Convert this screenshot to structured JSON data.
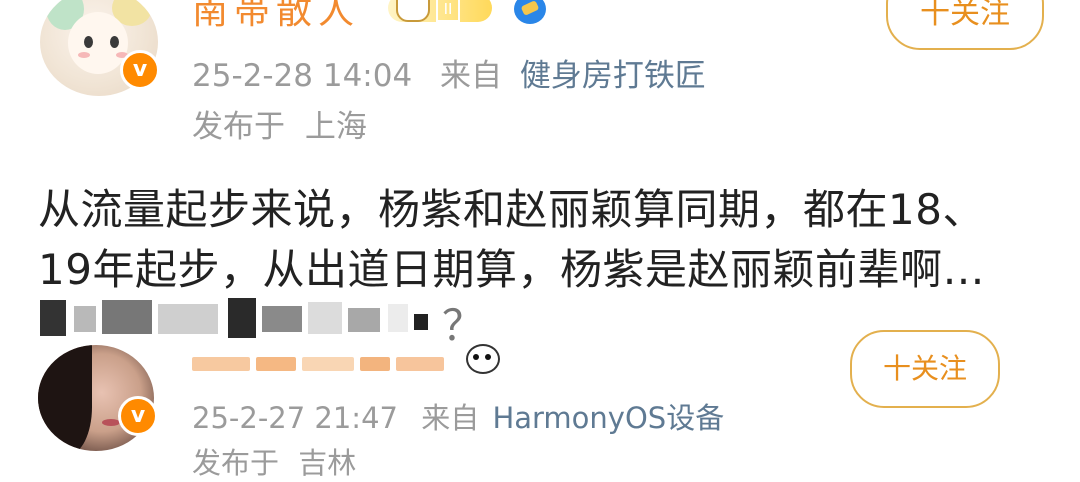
{
  "post1": {
    "username": "南帯散人",
    "timestamp": "25-2-28 14:04",
    "source_prefix": "来自",
    "source": "健身房打铁匠",
    "location_prefix": "发布于",
    "location": "上海",
    "follow_label": "十关注",
    "verified_mark": "v",
    "content_line1": "从流量起步来说，杨紫和赵丽颖算同期，都在18、",
    "content_line2": "19年起步，从出道日期算，杨紫是赵丽颖前辈啊…",
    "content_line3_visible_end": "？"
  },
  "post2": {
    "timestamp": "25-2-27 21:47",
    "source_prefix": "来自",
    "source": "HarmonyOS设备",
    "location_prefix": "发布于",
    "location": "吉林",
    "follow_label": "十关注",
    "verified_mark": "v"
  },
  "colors": {
    "username": "#f28a2f",
    "meta": "#9b9b9b",
    "source_link": "#5f7a93",
    "follow_border": "#e3b04e",
    "follow_text": "#e88f1e",
    "verified_badge": "#ff8a00",
    "body_text": "#222222"
  },
  "icons": {
    "post1_level": "level-badge-icon",
    "post1_vip": "vip-icon",
    "post2_emoji": "panda-emoji-icon"
  }
}
